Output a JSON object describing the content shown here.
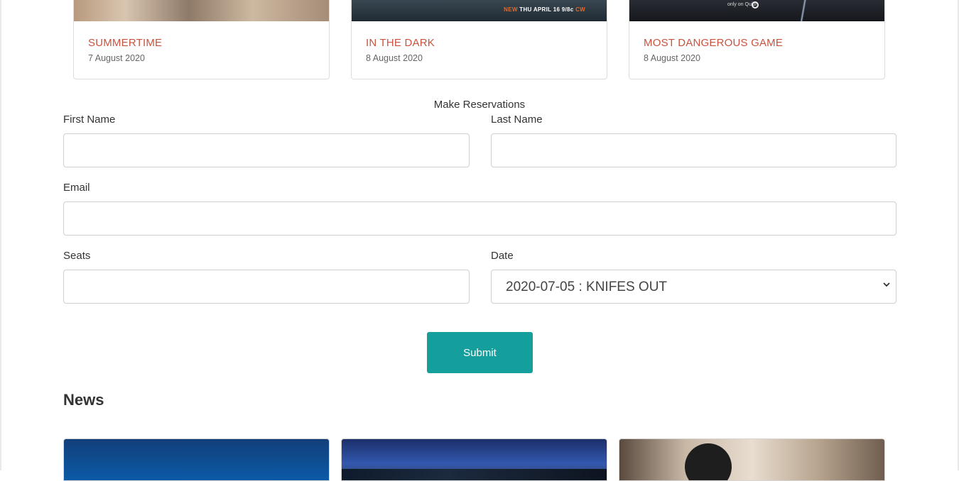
{
  "movies": [
    {
      "title": "SUMMERTIME",
      "date": "7 August 2020"
    },
    {
      "title": "IN THE DARK",
      "date": "8 August 2020",
      "banner_text": "NEW THU APRIL 16 9/8c",
      "banner_new": "NEW",
      "banner_rest": "THU APRIL 16 9/8c",
      "banner_logo": "CW"
    },
    {
      "title": "MOST DANGEROUS GAME",
      "date": "8 August 2020",
      "banner_text": "only on Quibi"
    }
  ],
  "form": {
    "heading": "Make Reservations",
    "first_name_label": "First Name",
    "first_name_value": "",
    "last_name_label": "Last Name",
    "last_name_value": "",
    "email_label": "Email",
    "email_value": "",
    "seats_label": "Seats",
    "seats_value": "",
    "date_label": "Date",
    "date_selected": "2020-07-05 : KNIFES OUT",
    "submit_label": "Submit"
  },
  "news": {
    "heading": "News"
  },
  "colors": {
    "accent": "#149f9c",
    "movie_title": "#c9533f"
  }
}
